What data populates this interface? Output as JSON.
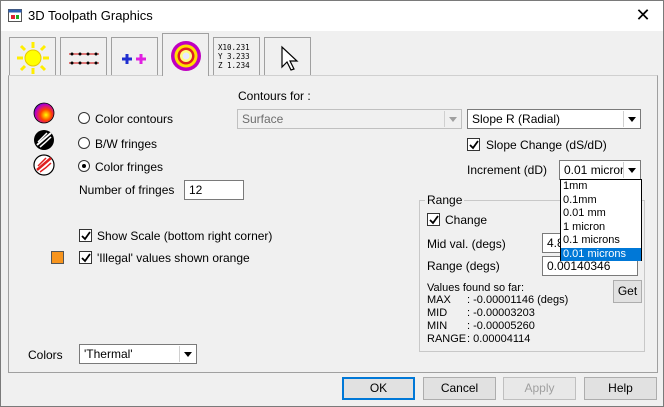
{
  "window": {
    "title": "3D Toolpath Graphics",
    "close_glyph": "✕"
  },
  "tabs": [
    {
      "icon": "sun-icon",
      "active": false
    },
    {
      "icon": "dotted-lines-icon",
      "active": false
    },
    {
      "icon": "plus-markers-icon",
      "active": false
    },
    {
      "icon": "target-rings-icon",
      "active": true
    },
    {
      "icon": "coordinates-icon",
      "lines": [
        "X10.231",
        "Y 3.233",
        "Z 1.234"
      ],
      "active": false
    },
    {
      "icon": "cursor-arrow-icon",
      "active": false
    }
  ],
  "display_mode": {
    "options": [
      {
        "label": "Color contours",
        "selected": false,
        "icon": "color-contours-icon"
      },
      {
        "label": "B/W fringes",
        "selected": false,
        "icon": "bw-fringes-icon"
      },
      {
        "label": "Color fringes",
        "selected": true,
        "icon": "color-fringes-icon"
      }
    ],
    "fringes_label": "Number of fringes",
    "fringes_value": "12"
  },
  "contours": {
    "label": "Contours for :",
    "surface_value": "Surface",
    "slope_value": "Slope R (Radial)",
    "slope_change_label": "Slope Change (dS/dD)",
    "slope_change_checked": true,
    "increment_label": "Increment (dD)",
    "increment_value": "0.01 microns",
    "increment_options": [
      "1mm",
      "0.1mm",
      "0.01 mm",
      "1 micron",
      "0.1 microns",
      "0.01 microns"
    ],
    "increment_selected_index": 5
  },
  "options": {
    "show_scale_label": "Show Scale (bottom right corner)",
    "show_scale_checked": true,
    "illegal_label": "'Illegal' values shown orange",
    "illegal_checked": true,
    "orange_swatch": "#f7941d"
  },
  "range": {
    "group_title": "Range",
    "change_label": "Change",
    "change_checked": true,
    "mid_label": "Mid val. (degs)",
    "mid_value": "4.8",
    "range_label": "Range  (degs)",
    "range_value": "0.00140346",
    "found_title": "Values found so far:",
    "max_label": "MAX",
    "max_value": ": -0.00001146  (degs)",
    "mid_row_label": "MID",
    "mid_row_value": ": -0.00003203",
    "min_label": "MIN",
    "min_value": ": -0.00005260",
    "range_row_label": "RANGE",
    "range_row_value": ": 0.00004114",
    "get_button": "Get"
  },
  "colors": {
    "label": "Colors",
    "value": "'Thermal'"
  },
  "buttons": {
    "ok": "OK",
    "cancel": "Cancel",
    "apply": "Apply",
    "help": "Help"
  }
}
